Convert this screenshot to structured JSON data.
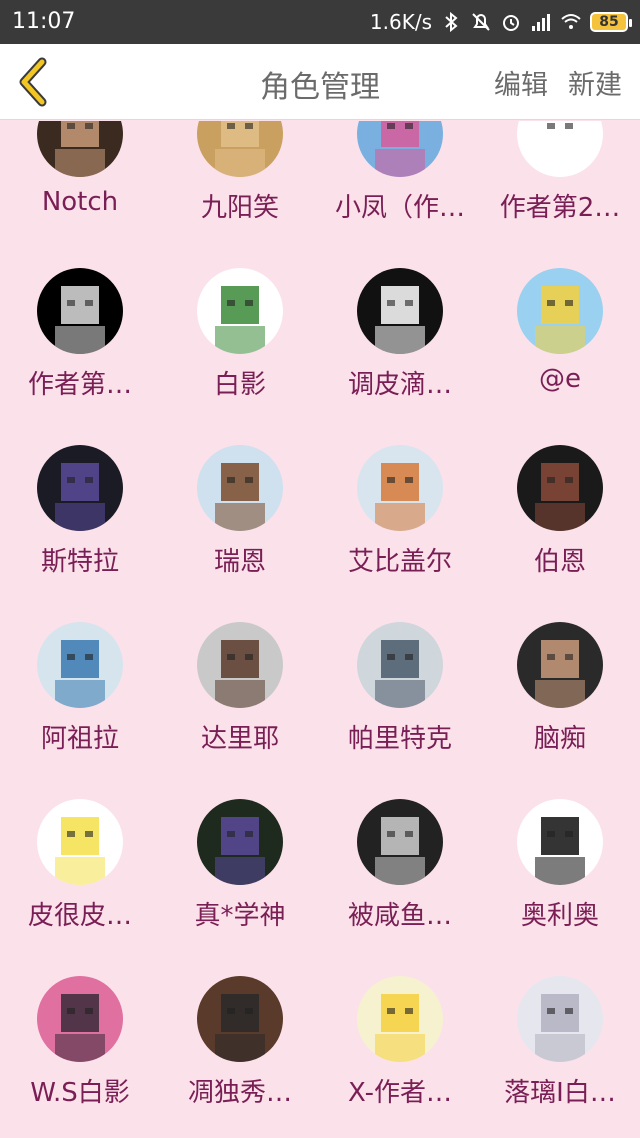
{
  "status_bar": {
    "time": "11:07",
    "speed": "1.6K/s",
    "battery": "85",
    "icons": [
      "bluetooth-icon",
      "bell-off-icon",
      "alarm-icon",
      "signal-icon",
      "wifi-icon"
    ]
  },
  "app_bar": {
    "title": "角色管理",
    "edit_label": "编辑",
    "new_label": "新建",
    "back_color": "#f2c623"
  },
  "characters": [
    {
      "name": "Notch",
      "bg": "#3b2a20",
      "fg": "#c99a7a"
    },
    {
      "name": "九阳笑",
      "bg": "#c9a060",
      "fg": "#e2c08a"
    },
    {
      "name": "小凤（作…",
      "bg": "#7ab0e0",
      "fg": "#d85a9a"
    },
    {
      "name": "作者第2…",
      "bg": "#ffffff",
      "fg": "#ffffff"
    },
    {
      "name": "作者第…",
      "bg": "#000000",
      "fg": "#dddddd"
    },
    {
      "name": "白影",
      "bg": "#ffffff",
      "fg": "#3a8a3a"
    },
    {
      "name": "调皮滴…",
      "bg": "#111111",
      "fg": "#ffffff"
    },
    {
      "name": "@e",
      "bg": "#9ad0f0",
      "fg": "#f4d03c"
    },
    {
      "name": "斯特拉",
      "bg": "#1b1b26",
      "fg": "#5a4a9a"
    },
    {
      "name": "瑞恩",
      "bg": "#cfe0ee",
      "fg": "#7a4a2a"
    },
    {
      "name": "艾比盖尔",
      "bg": "#d8e4ee",
      "fg": "#d87a3a"
    },
    {
      "name": "伯恩",
      "bg": "#1a1a1a",
      "fg": "#8a4a3a"
    },
    {
      "name": "阿祖拉",
      "bg": "#d6e4ee",
      "fg": "#3a7ab0"
    },
    {
      "name": "达里耶",
      "bg": "#c9c9c9",
      "fg": "#5a3a2a"
    },
    {
      "name": "帕里特克",
      "bg": "#cfd6dc",
      "fg": "#4a5a6a"
    },
    {
      "name": "脑痴",
      "bg": "#2a2a2a",
      "fg": "#c99a7a"
    },
    {
      "name": "皮很皮…",
      "bg": "#ffffff",
      "fg": "#f4e04a"
    },
    {
      "name": "真*学神",
      "bg": "#1e2a1e",
      "fg": "#5a4a9a"
    },
    {
      "name": "被咸鱼…",
      "bg": "#222222",
      "fg": "#cfcfcf"
    },
    {
      "name": "奥利奥",
      "bg": "#ffffff",
      "fg": "#111111"
    },
    {
      "name": "W.S白影",
      "bg": "#e070a0",
      "fg": "#3a2a3a"
    },
    {
      "name": "凋独秀…",
      "bg": "#5a3a2a",
      "fg": "#2a2a2a"
    },
    {
      "name": "X-作者…",
      "bg": "#f6f2d0",
      "fg": "#f4d03c"
    },
    {
      "name": "落璃I白…",
      "bg": "#e6e6ee",
      "fg": "#b0b0c0"
    }
  ]
}
